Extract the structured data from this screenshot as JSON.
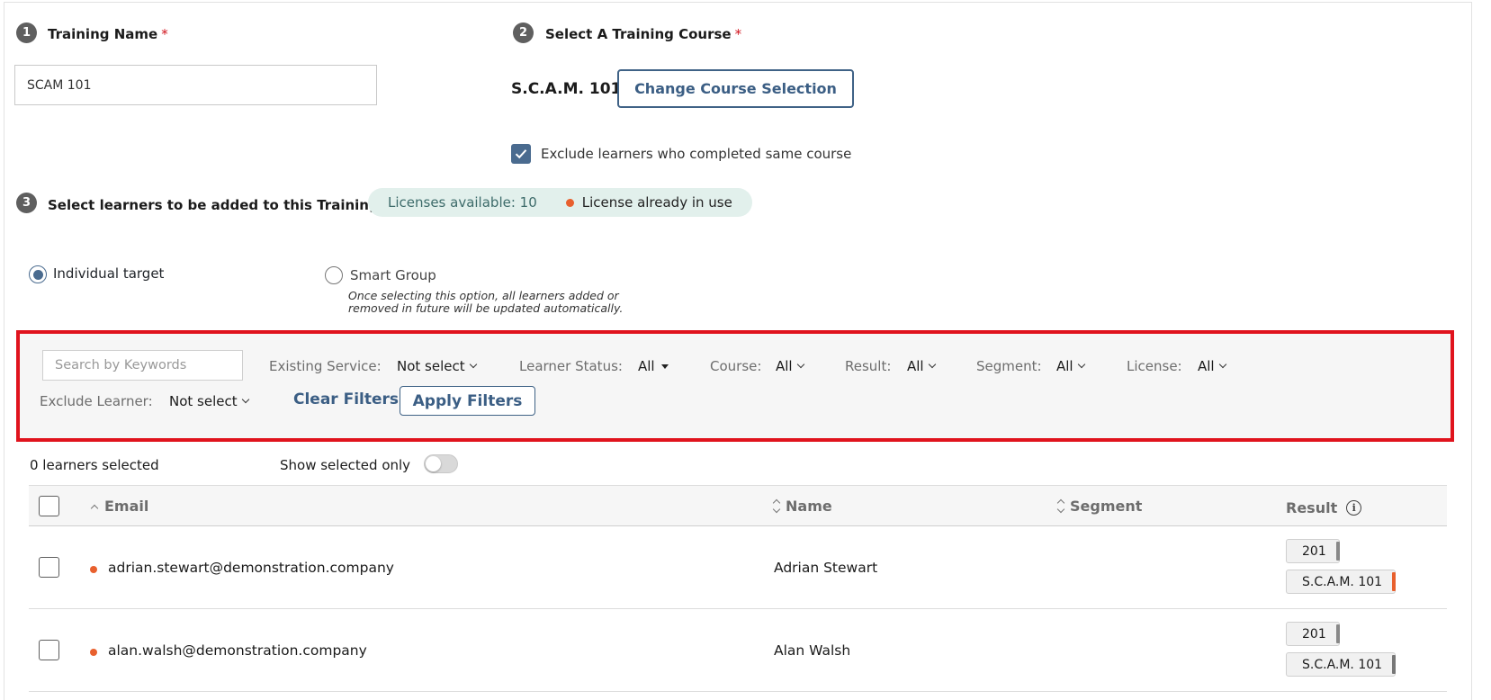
{
  "step1": {
    "number": "1",
    "title": "Training Name",
    "required": "*",
    "value": "SCAM 101"
  },
  "step2": {
    "number": "2",
    "title": "Select A Training Course",
    "required": "*",
    "course_name": "S.C.A.M. 101",
    "change_button": "Change Course Selection",
    "exclude_checkbox": {
      "checked": true,
      "label": "Exclude learners who completed same course"
    }
  },
  "step3": {
    "number": "3",
    "title": "Select learners to be added to this Training",
    "required": "*",
    "licenses_available": "Licenses available: 10",
    "license_in_use": "License already in use"
  },
  "targeting": {
    "individual": {
      "label": "Individual target",
      "selected": true
    },
    "smart_group": {
      "label": "Smart Group",
      "selected": false,
      "description": "Once selecting this option, all learners added or removed in future will be updated automatically."
    }
  },
  "filters": {
    "search_placeholder": "Search by Keywords",
    "existing_service": {
      "label": "Existing Service:",
      "value": "Not select"
    },
    "learner_status": {
      "label": "Learner Status:",
      "value": "All"
    },
    "course": {
      "label": "Course:",
      "value": "All"
    },
    "result": {
      "label": "Result:",
      "value": "All"
    },
    "segment": {
      "label": "Segment:",
      "value": "All"
    },
    "license": {
      "label": "License:",
      "value": "All"
    },
    "exclude_learner": {
      "label": "Exclude Learner:",
      "value": "Not select"
    },
    "clear": "Clear Filters",
    "apply": "Apply Filters"
  },
  "selection": {
    "count_text": "0 learners selected",
    "show_selected_label": "Show selected only",
    "show_selected_on": false
  },
  "table": {
    "columns": {
      "email": "Email",
      "name": "Name",
      "segment": "Segment",
      "result": "Result"
    },
    "rows": [
      {
        "email": "adrian.stewart@demonstration.company",
        "name": "Adrian Stewart",
        "segment": "",
        "results": [
          "201",
          "S.C.A.M. 101"
        ]
      },
      {
        "email": "alan.walsh@demonstration.company",
        "name": "Alan Walsh",
        "segment": "",
        "results": [
          "201",
          "S.C.A.M. 101"
        ]
      }
    ]
  },
  "colors": {
    "accent": "#3b5e84",
    "required": "#d0121b",
    "license_dot": "#e8602e",
    "filter_border": "#e0131d",
    "pill_bg": "#e2f0ec"
  }
}
